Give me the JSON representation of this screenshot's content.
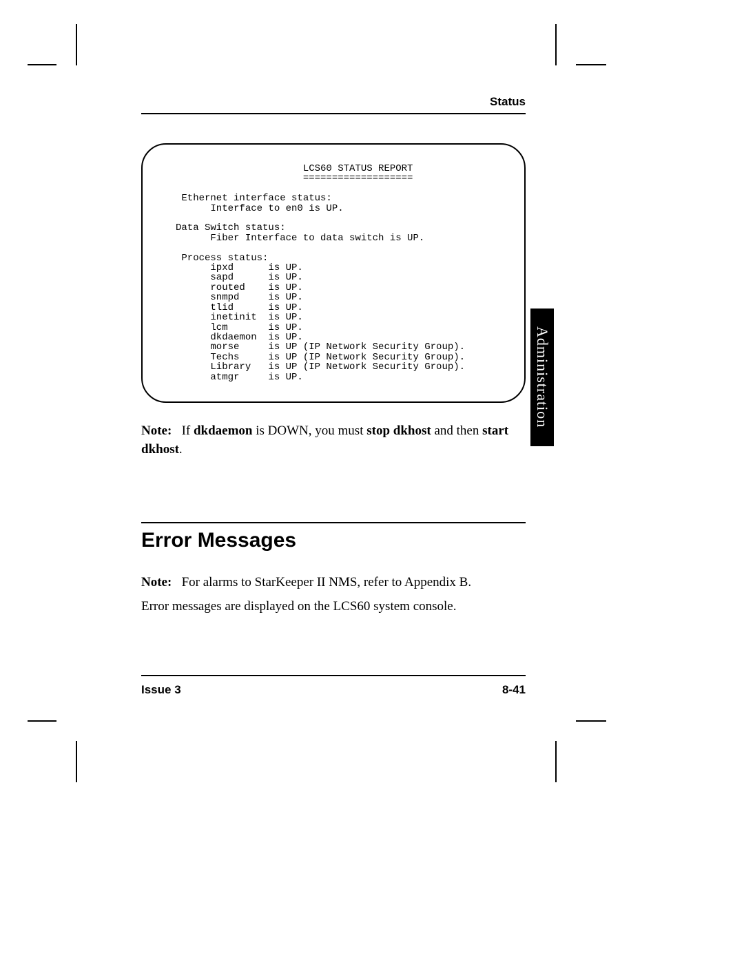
{
  "header": {
    "status_label": "Status"
  },
  "report": {
    "text": "                      LCS60 STATUS REPORT\n                      ===================\n\n Ethernet interface status:\n      Interface to en0 is UP.\n\nData Switch status:\n      Fiber Interface to data switch is UP.\n\n Process status:\n      ipxd      is UP.\n      sapd      is UP.\n      routed    is UP.\n      snmpd     is UP.\n      tlid      is UP.\n      inetinit  is UP.\n      lcm       is UP.\n      dkdaemon  is UP.\n      morse     is UP (IP Network Security Group).\n      Techs     is UP (IP Network Security Group).\n      Library   is UP (IP Network Security Group).\n      atmgr     is UP."
  },
  "note1": {
    "label": "Note:",
    "t1": "If ",
    "b1": "dkdaemon",
    "t2": " is DOWN, you must ",
    "b2": "stop dkhost",
    "t3": " and then ",
    "b3": "start dkhost",
    "t4": "."
  },
  "section": {
    "heading": "Error Messages"
  },
  "note2": {
    "label": "Note:",
    "text": "For alarms to StarKeeper II NMS, refer to Appendix B."
  },
  "body": {
    "text": "Error messages are displayed on the LCS60 system console."
  },
  "footer": {
    "issue": "Issue 3",
    "page": "8-41"
  },
  "sidetab": {
    "label": "Administration"
  }
}
